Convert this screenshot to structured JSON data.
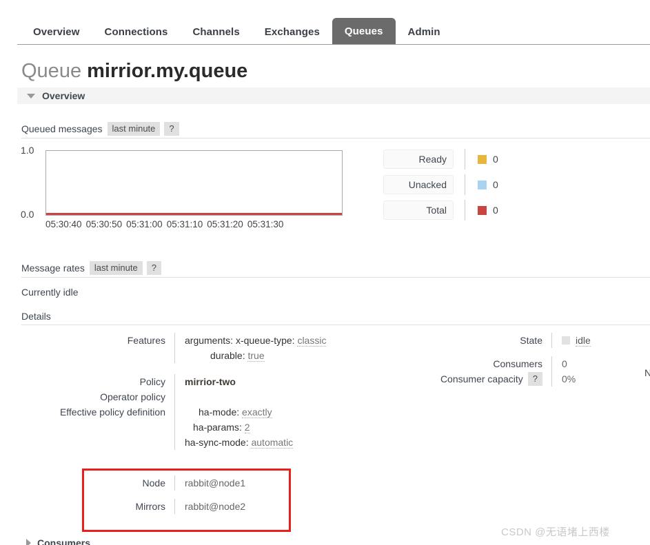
{
  "nav": {
    "tabs": [
      {
        "label": "Overview",
        "active": false
      },
      {
        "label": "Connections",
        "active": false
      },
      {
        "label": "Channels",
        "active": false
      },
      {
        "label": "Exchanges",
        "active": false
      },
      {
        "label": "Queues",
        "active": true
      },
      {
        "label": "Admin",
        "active": false
      }
    ]
  },
  "page": {
    "title_prefix": "Queue",
    "title_name": "mirrior.my.queue"
  },
  "overview_section": {
    "header_label": "Overview"
  },
  "queued_messages": {
    "label": "Queued messages",
    "period_chip": "last minute",
    "help_chip": "?"
  },
  "message_rates": {
    "label": "Message rates",
    "period_chip": "last minute",
    "help_chip": "?",
    "status": "Currently idle"
  },
  "details_header": "Details",
  "stats": [
    {
      "key": "Ready",
      "value": "0",
      "color": "#e8b63c"
    },
    {
      "key": "Unacked",
      "value": "0",
      "color": "#a9d3f0"
    },
    {
      "key": "Total",
      "value": "0",
      "color": "#c9453f"
    }
  ],
  "details_left": {
    "features_key": "Features",
    "features": [
      {
        "k": "arguments:",
        "k2": "x-queue-type:",
        "v": "classic"
      },
      {
        "k": "durable:",
        "v": "true"
      }
    ],
    "policy_key": "Policy",
    "policy_value": "mirrior-two",
    "operator_policy_key": "Operator policy",
    "operator_policy_value": "",
    "effective_policy_key": "Effective policy definition",
    "effective_policy": [
      {
        "k": "ha-mode:",
        "v": "exactly"
      },
      {
        "k": "ha-params:",
        "v": "2"
      },
      {
        "k": "ha-sync-mode:",
        "v": "automatic"
      }
    ],
    "node_key": "Node",
    "node_value": "rabbit@node1",
    "mirrors_key": "Mirrors",
    "mirrors_value": "rabbit@node2"
  },
  "details_right": {
    "state_key": "State",
    "state_value": "idle",
    "consumers_key": "Consumers",
    "consumers_value": "0",
    "consumer_capacity_key": "Consumer capacity",
    "consumer_capacity_help": "?",
    "consumer_capacity_value": "0%"
  },
  "consumers_section": {
    "header_label": "Consumers"
  },
  "edge_cut_text": "N",
  "watermark": "CSDN @无语堵上西楼",
  "chart_data": {
    "type": "line",
    "title": "Queued messages",
    "xlabel": "",
    "ylabel": "",
    "ylim": [
      0.0,
      1.0
    ],
    "ytick_labels": [
      "1.0",
      "0.0"
    ],
    "xtick_labels": [
      "05:30:40",
      "05:30:50",
      "05:31:00",
      "05:31:10",
      "05:31:20",
      "05:31:30"
    ],
    "grid": false,
    "legend_position": "right",
    "series": [
      {
        "name": "Ready",
        "color": "#e8b63c",
        "values": [
          0,
          0,
          0,
          0,
          0,
          0
        ]
      },
      {
        "name": "Unacked",
        "color": "#a9d3f0",
        "values": [
          0,
          0,
          0,
          0,
          0,
          0
        ]
      },
      {
        "name": "Total",
        "color": "#c9453f",
        "values": [
          0,
          0,
          0,
          0,
          0,
          0
        ]
      }
    ]
  }
}
